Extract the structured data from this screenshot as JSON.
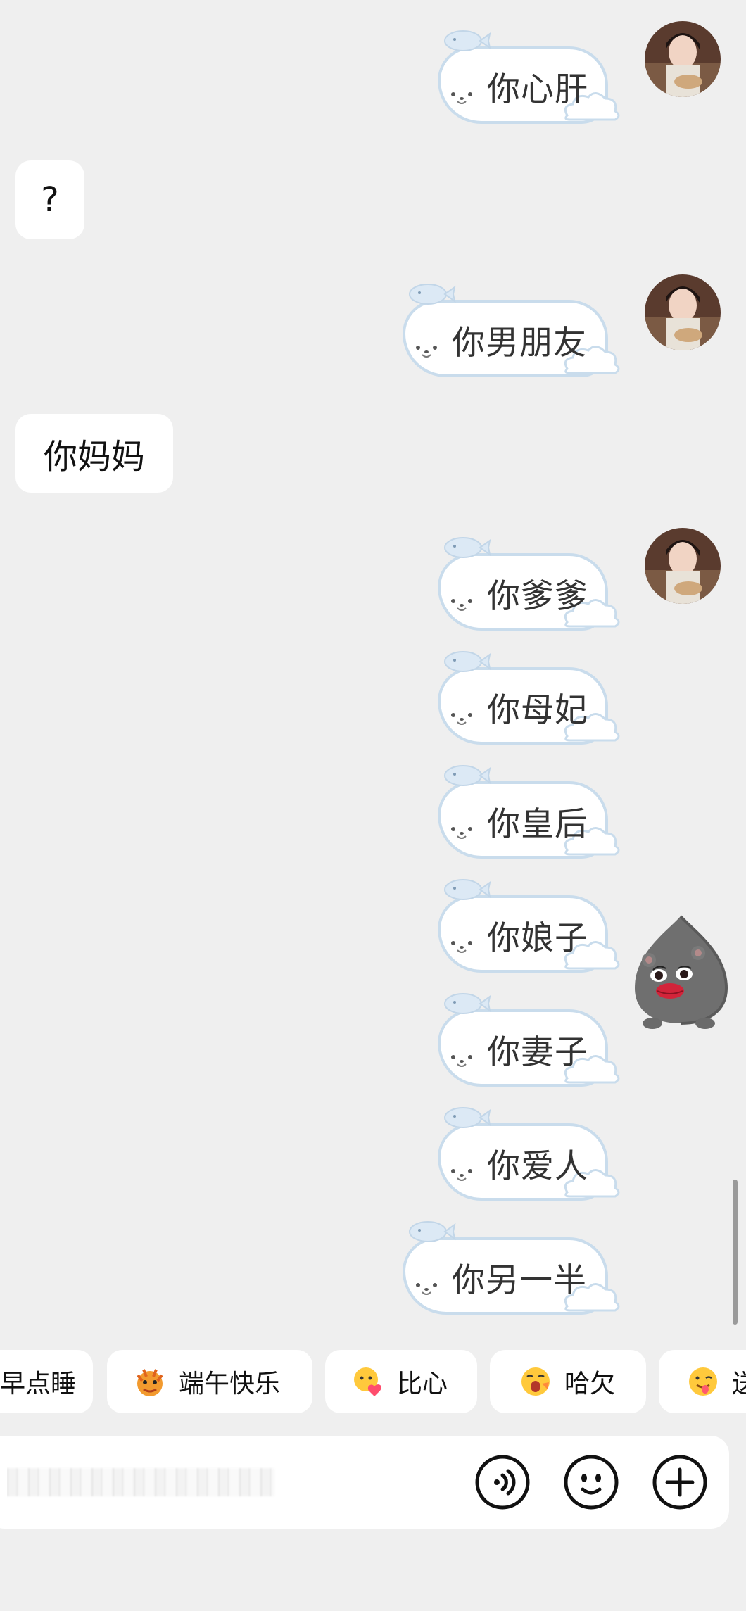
{
  "chat": {
    "messages": [
      {
        "side": "out",
        "text": "你心肝"
      },
      {
        "side": "in",
        "text": "?"
      },
      {
        "side": "out",
        "text": "你男朋友"
      },
      {
        "side": "in",
        "text": "你妈妈"
      },
      {
        "side": "out",
        "text": "你爹爹"
      },
      {
        "side": "out",
        "text": "你母妃"
      },
      {
        "side": "out",
        "text": "你皇后"
      },
      {
        "side": "out",
        "text": "你娘子"
      },
      {
        "side": "out",
        "text": "你妻子"
      },
      {
        "side": "out",
        "text": "你爱人"
      },
      {
        "side": "out",
        "text": "你另一半"
      }
    ]
  },
  "quick_replies": [
    {
      "label": "早点睡",
      "icon": "moon-emoji"
    },
    {
      "label": "端午快乐",
      "icon": "dragon-emoji"
    },
    {
      "label": "比心",
      "icon": "heart-hands-emoji"
    },
    {
      "label": "哈欠",
      "icon": "yawn-emoji"
    },
    {
      "label": "送",
      "icon": "tongue-emoji"
    }
  ],
  "input": {
    "placeholder": "",
    "voice_icon": "voice-icon",
    "emoji_icon": "emoji-icon",
    "plus_icon": "plus-icon"
  },
  "colors": {
    "background": "#efefef",
    "bubble": "#ffffff",
    "seal_outline": "#c9dcec"
  }
}
